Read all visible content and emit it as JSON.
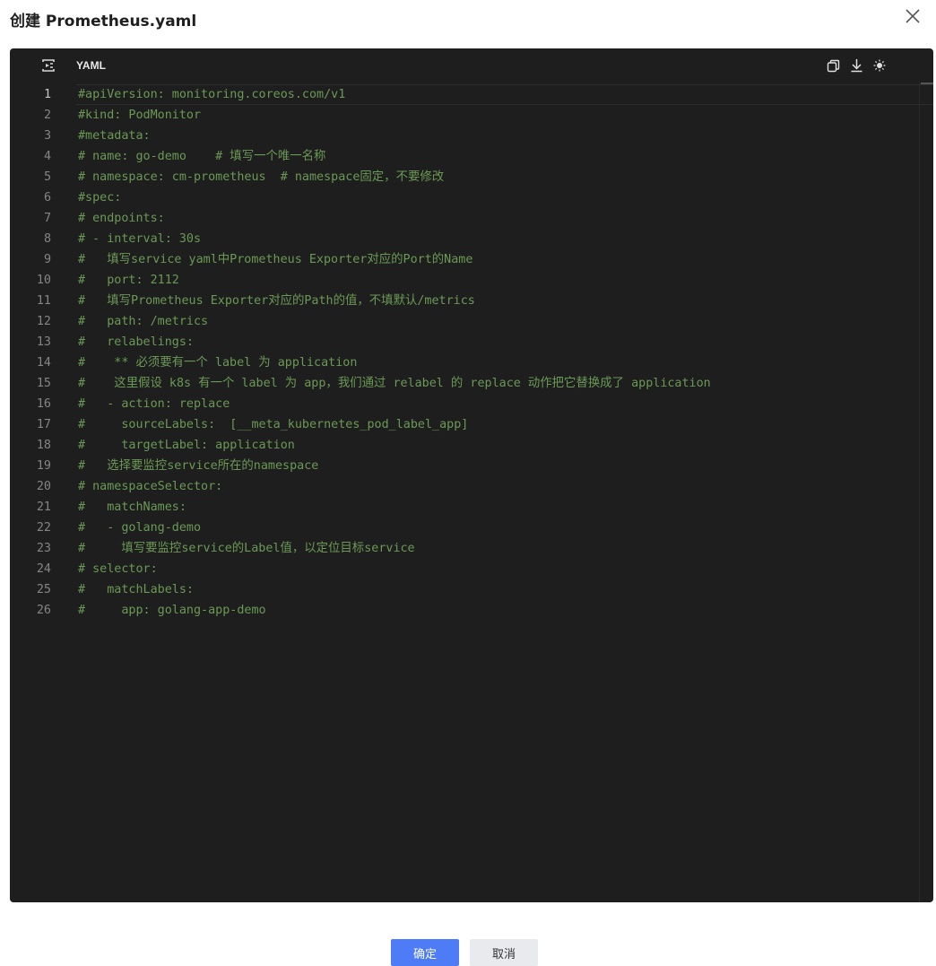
{
  "dialog": {
    "title": "创建 Prometheus.yaml"
  },
  "editor": {
    "language": "YAML",
    "icons": [
      "format-icon",
      "copy-icon",
      "download-icon",
      "theme-icon"
    ],
    "active_line": 1,
    "colors": {
      "background": "#1e1e1e",
      "comment": "#6a9955",
      "line_number": "#858585"
    },
    "lines": [
      "#apiVersion: monitoring.coreos.com/v1",
      "#kind: PodMonitor",
      "#metadata:",
      "# name: go-demo    # 填写一个唯一名称",
      "# namespace: cm-prometheus  # namespace固定，不要修改",
      "#spec:",
      "# endpoints:",
      "# - interval: 30s",
      "#   填写service yaml中Prometheus Exporter对应的Port的Name",
      "#   port: 2112",
      "#   填写Prometheus Exporter对应的Path的值，不填默认/metrics",
      "#   path: /metrics",
      "#   relabelings:",
      "#    ** 必须要有一个 label 为 application",
      "#    这里假设 k8s 有一个 label 为 app，我们通过 relabel 的 replace 动作把它替换成了 application",
      "#   - action: replace",
      "#     sourceLabels:  [__meta_kubernetes_pod_label_app]",
      "#     targetLabel: application",
      "#   选择要监控service所在的namespace",
      "# namespaceSelector:",
      "#   matchNames:",
      "#   - golang-demo",
      "#     填写要监控service的Label值，以定位目标service",
      "# selector:",
      "#   matchLabels:",
      "#     app: golang-app-demo"
    ]
  },
  "footer": {
    "confirm_label": "确定",
    "cancel_label": "取消",
    "primary_color": "#4e7cf6"
  }
}
